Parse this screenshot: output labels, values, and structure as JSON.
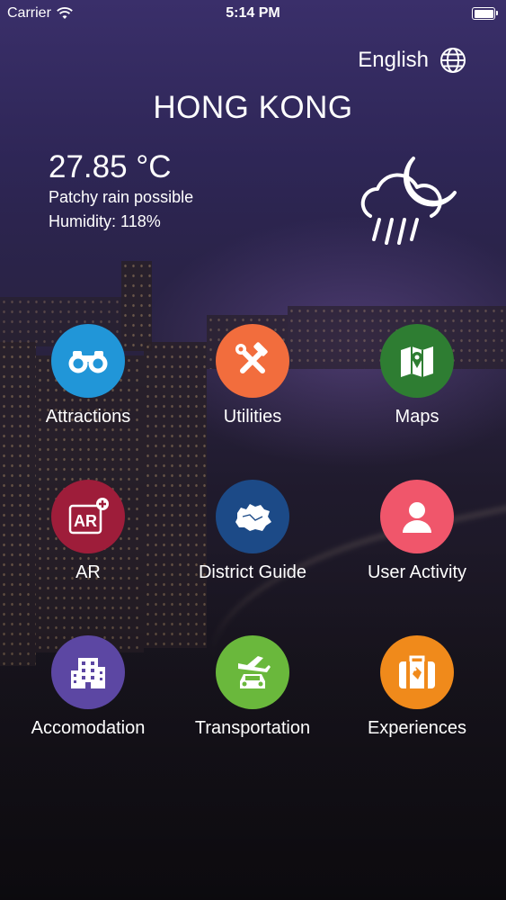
{
  "status": {
    "carrier": "Carrier",
    "time": "5:14 PM"
  },
  "header": {
    "language": "English",
    "city": "HONG KONG"
  },
  "weather": {
    "temperature": "27.85 °C",
    "condition": "Patchy rain possible",
    "humidity": "Humidity: 118%",
    "icon": "rain-cloud-moon-icon"
  },
  "menu": [
    {
      "label": "Attractions",
      "icon": "binoculars-icon",
      "color": "#2196d8"
    },
    {
      "label": "Utilities",
      "icon": "tools-icon",
      "color": "#f26d3d"
    },
    {
      "label": "Maps",
      "icon": "map-icon",
      "color": "#2e7d32"
    },
    {
      "label": "AR",
      "icon": "ar-icon",
      "color": "#9e1d3a"
    },
    {
      "label": "District Guide",
      "icon": "district-map-icon",
      "color": "#1c4a87"
    },
    {
      "label": "User Activity",
      "icon": "user-icon",
      "color": "#f0566b"
    },
    {
      "label": "Accomodation",
      "icon": "building-icon",
      "color": "#5c47a3"
    },
    {
      "label": "Transportation",
      "icon": "plane-car-icon",
      "color": "#6ab83c"
    },
    {
      "label": "Experiences",
      "icon": "suitcase-icon",
      "color": "#f08a1b"
    }
  ]
}
